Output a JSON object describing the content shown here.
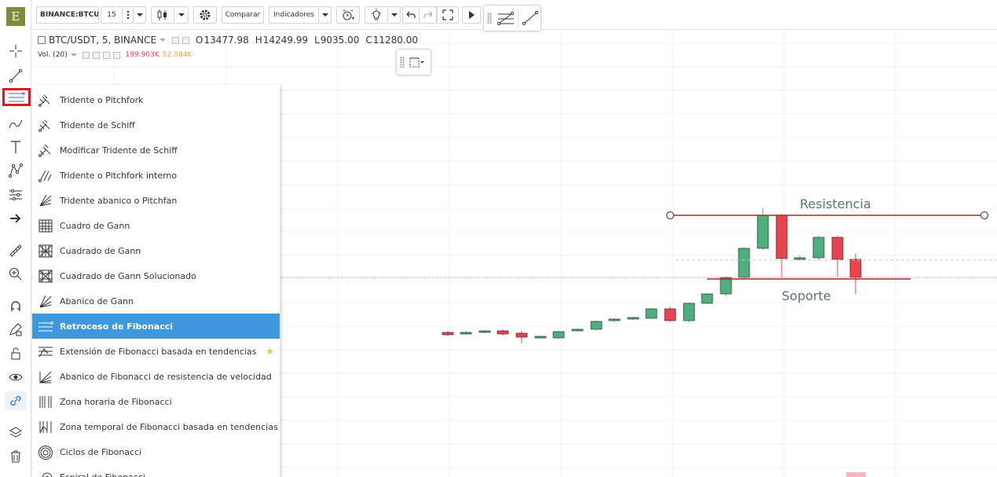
{
  "toolbar": {
    "logo": "E",
    "symbol": "BINANCE:BTCUSDT",
    "interval": "15",
    "compare": "Comparar",
    "indicators": "Indicadores"
  },
  "legend": {
    "title": "BTC/USDT, 5, BINANCE",
    "open_key": "O",
    "open": "13477.98",
    "high_key": "H",
    "high": "14249.99",
    "low_key": "L",
    "low": "9035.00",
    "close_key": "C",
    "close": "11280.00",
    "volume_label": "Vol. (20)",
    "volume_1": "199.903K",
    "volume_2": "52.084K"
  },
  "menu": {
    "items": [
      {
        "label": "Tridente o Pitchfork",
        "icon": "pitchfork-icon"
      },
      {
        "label": "Tridente de Schiff",
        "icon": "schiff-pitchfork-icon"
      },
      {
        "label": "Modificar Tridente de Schiff",
        "icon": "modified-schiff-pitchfork-icon"
      },
      {
        "label": "Tridente o Pitchfork interno",
        "icon": "inside-pitchfork-icon"
      },
      {
        "label": "Tridente abanico o Pitchfan",
        "icon": "pitchfan-icon"
      },
      {
        "label": "Cuadro de Gann",
        "icon": "gann-box-icon"
      },
      {
        "label": "Cuadrado de Gann",
        "icon": "gann-square-icon"
      },
      {
        "label": "Cuadrado de Gann Solucionado",
        "icon": "gann-square-fixed-icon"
      },
      {
        "label": "Abanico de Gann",
        "icon": "gann-fan-icon"
      },
      {
        "label": "Retroceso de Fibonacci",
        "icon": "fib-retracement-icon"
      },
      {
        "label": "Extensión de Fibonacci basada en tendencias",
        "icon": "fib-extension-icon"
      },
      {
        "label": "Abanico de Fibonacci de resistencia de velocidad",
        "icon": "fib-speed-fan-icon"
      },
      {
        "label": "Zona horaria de Fibonacci",
        "icon": "fib-time-zone-icon"
      },
      {
        "label": "Zona temporal de Fibonacci basada en tendencias",
        "icon": "fib-trend-time-icon"
      },
      {
        "label": "Ciclos de Fibonacci",
        "icon": "fib-circles-icon"
      },
      {
        "label": "Espiral de Fibonacci",
        "icon": "fib-spiral-icon"
      }
    ],
    "active_index": 9,
    "favorite_index": 10
  },
  "annotations": {
    "resistance": "Resistencia",
    "support": "Soporte"
  },
  "colors": {
    "up": "#4caf7d",
    "down": "#e8434f",
    "accent": "#3d98e0",
    "resistance_line": "#a52a2a"
  }
}
